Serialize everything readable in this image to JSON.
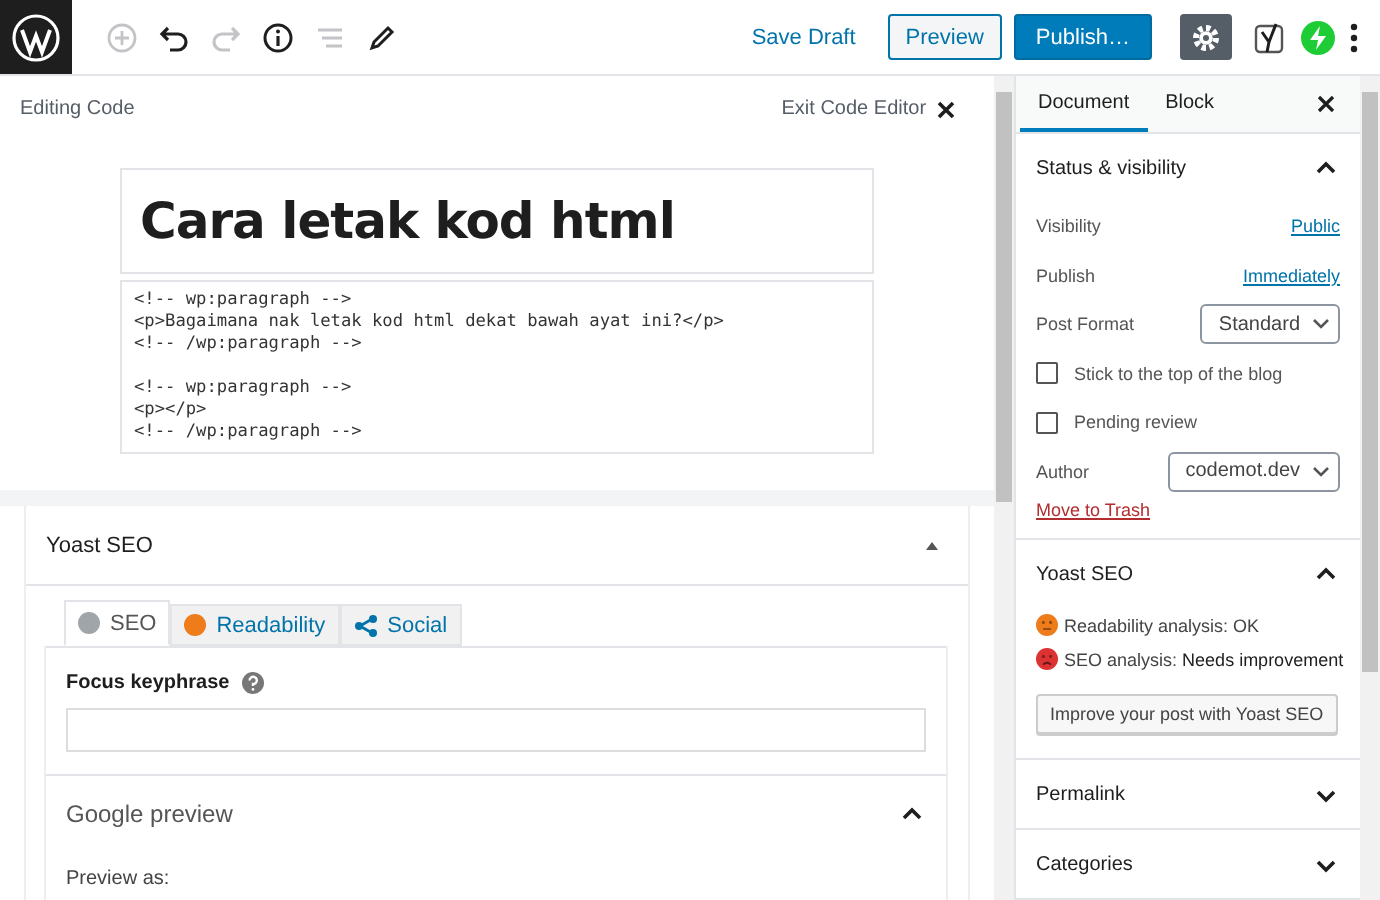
{
  "toolbar": {
    "save_draft": "Save Draft",
    "preview": "Preview",
    "publish": "Publish…",
    "settings_on": true
  },
  "editor": {
    "mode_label": "Editing Code",
    "exit_label": "Exit Code Editor",
    "title": "Cara letak kod html",
    "code": "<!-- wp:paragraph -->\n<p>Bagaimana nak letak kod html dekat bawah ayat ini?</p>\n<!-- /wp:paragraph -->\n\n<!-- wp:paragraph -->\n<p></p>\n<!-- /wp:paragraph -->"
  },
  "yoast_panel": {
    "title": "Yoast SEO",
    "expanded": true,
    "tabs": [
      {
        "label": "SEO",
        "kind": "dot",
        "color": "#a0a5aa",
        "selected": true
      },
      {
        "label": "Readability",
        "kind": "dot",
        "color": "#ee7c1b",
        "selected": false
      },
      {
        "label": "Social",
        "kind": "share",
        "selected": false
      }
    ],
    "focus_label": "Focus keyphrase",
    "google_preview": {
      "title": "Google preview",
      "expanded": true
    },
    "preview_as": "Preview as:"
  },
  "sidebar": {
    "tabs": [
      {
        "label": "Document",
        "selected": true
      },
      {
        "label": "Block",
        "selected": false
      }
    ],
    "sections": [
      {
        "kind": "status",
        "title": "Status & visibility",
        "expanded": true,
        "rows": [
          {
            "kind": "link",
            "label": "Visibility",
            "value": "Public"
          },
          {
            "kind": "link",
            "label": "Publish",
            "value": "Immediately"
          },
          {
            "kind": "select",
            "label": "Post Format",
            "value": "Standard"
          },
          {
            "kind": "checkbox",
            "label": "Stick to the top of the blog",
            "checked": false
          },
          {
            "kind": "checkbox",
            "label": "Pending review",
            "checked": false
          },
          {
            "kind": "select",
            "label": "Author",
            "value": "codemot.dev"
          }
        ],
        "trash": "Move to Trash"
      },
      {
        "kind": "yoast",
        "title": "Yoast SEO",
        "expanded": true,
        "analyses": [
          {
            "text": "Readability analysis: OK",
            "color": "#ee7c1b",
            "kind": "neutral"
          },
          {
            "text": "SEO analysis: **Needs improvement**",
            "color": "#dc3232",
            "kind": "sad"
          }
        ],
        "button": "Improve your post with Yoast SEO"
      },
      {
        "kind": "plain",
        "title": "Permalink",
        "expanded": false
      },
      {
        "kind": "plain",
        "title": "Categories",
        "expanded": false
      }
    ]
  }
}
